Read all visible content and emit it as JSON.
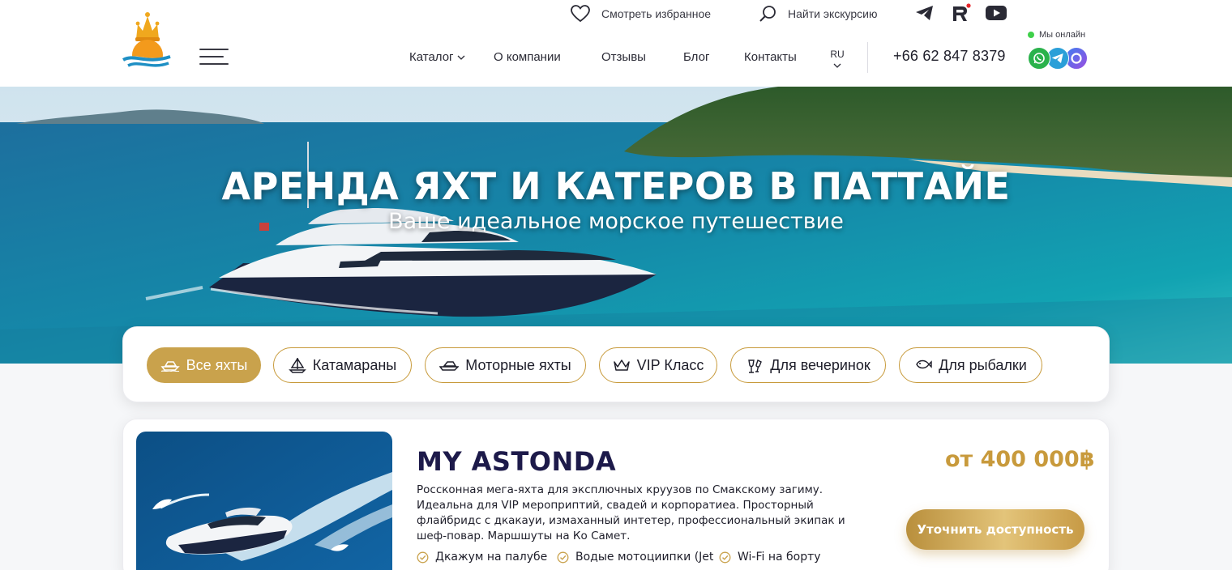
{
  "header": {
    "favorites_label": "Смотреть избранное",
    "search_label": "Найти экскурсию",
    "nav": {
      "catalog": "Каталог",
      "about": "О компании",
      "reviews": "Отзывы",
      "blog": "Блог",
      "contacts": "Контакты"
    },
    "lang": "RU",
    "phone": "+66 62 847 8379",
    "online_label": "Мы онлайн",
    "social_icons": [
      "telegram-icon",
      "rutube-icon",
      "youtube-icon"
    ],
    "messenger_icons": [
      "whatsapp-icon",
      "telegram-icon",
      "max-messenger-icon"
    ]
  },
  "hero": {
    "title": "АРЕНДА ЯХТ И КАТЕРОВ В ПАТТАЙЕ",
    "subtitle": "Ваше идеальное морское путешествие"
  },
  "filters": [
    {
      "label": "Все яхты",
      "icon": "yacht-icon",
      "active": true
    },
    {
      "label": "Катамараны",
      "icon": "sailboat-icon",
      "active": false
    },
    {
      "label": "Моторные яхты",
      "icon": "motor-yacht-icon",
      "active": false
    },
    {
      "label": "VIP Класс",
      "icon": "crown-icon",
      "active": false
    },
    {
      "label": "Для вечеринок",
      "icon": "champagne-icon",
      "active": false
    },
    {
      "label": "Для рыбалки",
      "icon": "fish-icon",
      "active": false
    }
  ],
  "card": {
    "title": "MY ASTONDA",
    "description": "Россконная мега-яхта для эксплючных круузов по Смакскому загиму. Идеальна для VIP мероприптий, свадей и корпоратиеа. Просторный флайбридс с дкакауи, измаханный интетер, профессиональный экипак и шеф-повар. Маршшуты на Ко Самет.",
    "price": "от 400 000฿",
    "cta_label": "Уточнить доступность",
    "features": [
      "Дкажум на палубе",
      "Водые мотоциипки (Jet",
      "Wi-Fi на борту"
    ]
  },
  "colors": {
    "accent_gold": "#c9a24c",
    "title_navy": "#1d1a4a",
    "online_green": "#3fd04a"
  }
}
